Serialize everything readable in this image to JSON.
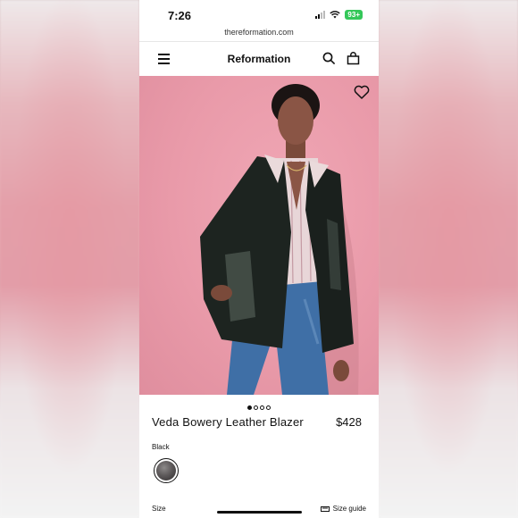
{
  "status": {
    "time": "7:26",
    "battery": "93+"
  },
  "browser": {
    "url": "thereformation.com"
  },
  "nav": {
    "brand": "Reformation"
  },
  "gallery": {
    "dot_count": 4,
    "active_index": 0
  },
  "product": {
    "title": "Veda Bowery Leather Blazer",
    "price": "$428",
    "color_label": "Black",
    "size_label": "Size",
    "size_guide": "Size guide"
  },
  "colors": {
    "swatch": "#4a4647"
  }
}
